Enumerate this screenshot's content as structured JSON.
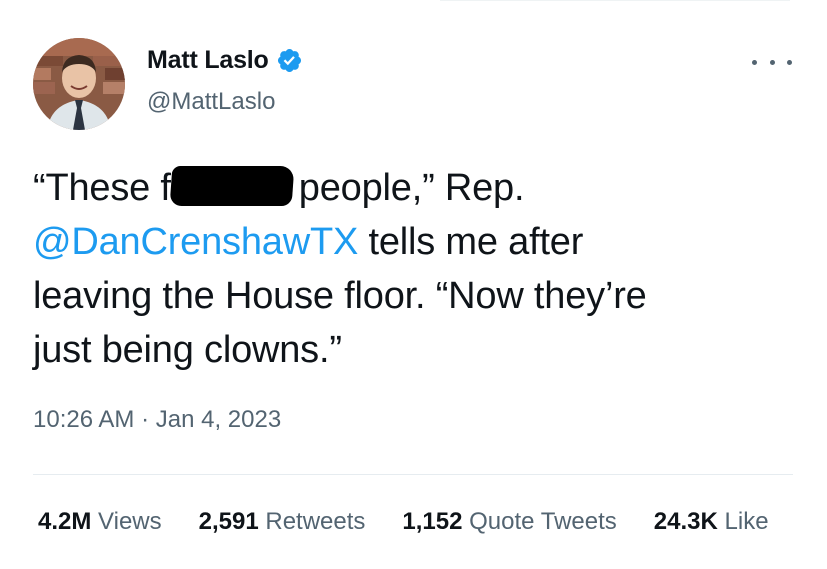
{
  "author": {
    "display_name": "Matt Laslo",
    "handle": "@MattLaslo",
    "verified": true
  },
  "tweet": {
    "line1_before": "“These f",
    "line1_after": "people,” Rep.",
    "mention": "@DanCrenshawTX",
    "line2_after": " tells me after",
    "line3": "leaving the House floor. “Now they’re",
    "line4": "just being clowns.”"
  },
  "timestamp": "10:26 AM · Jan 4, 2023",
  "stats": {
    "views_value": "4.2M",
    "views_label": "Views",
    "retweets_value": "2,591",
    "retweets_label": "Retweets",
    "quotes_value": "1,152",
    "quotes_label": "Quote Tweets",
    "likes_value": "24.3K",
    "likes_label": "Like"
  },
  "icons": {
    "verified": "verified-badge-icon",
    "more": "more-options-icon"
  },
  "colors": {
    "accent": "#1d9bf0",
    "text": "#0f1419",
    "secondary": "#536471"
  }
}
